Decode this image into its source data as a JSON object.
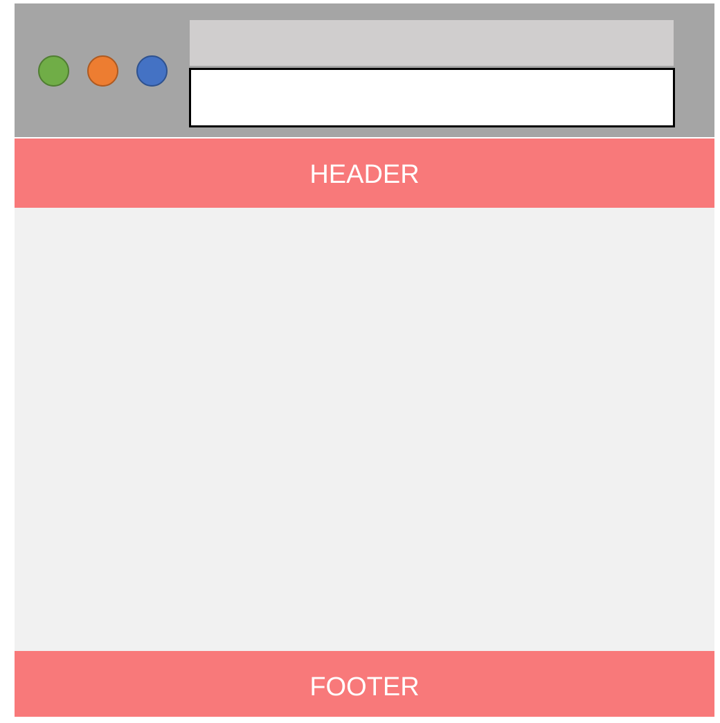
{
  "window": {
    "buttons": [
      {
        "name": "green",
        "color": "#70ad47"
      },
      {
        "name": "orange",
        "color": "#ed7d31"
      },
      {
        "name": "blue",
        "color": "#4472c4"
      }
    ],
    "address_bar": {
      "value": ""
    }
  },
  "header": {
    "label": "HEADER"
  },
  "footer": {
    "label": "FOOTER"
  },
  "colors": {
    "titlebar": "#a5a5a5",
    "tabstrip": "#d0cece",
    "header_footer": "#f8797a",
    "content": "#f1f1f1"
  }
}
